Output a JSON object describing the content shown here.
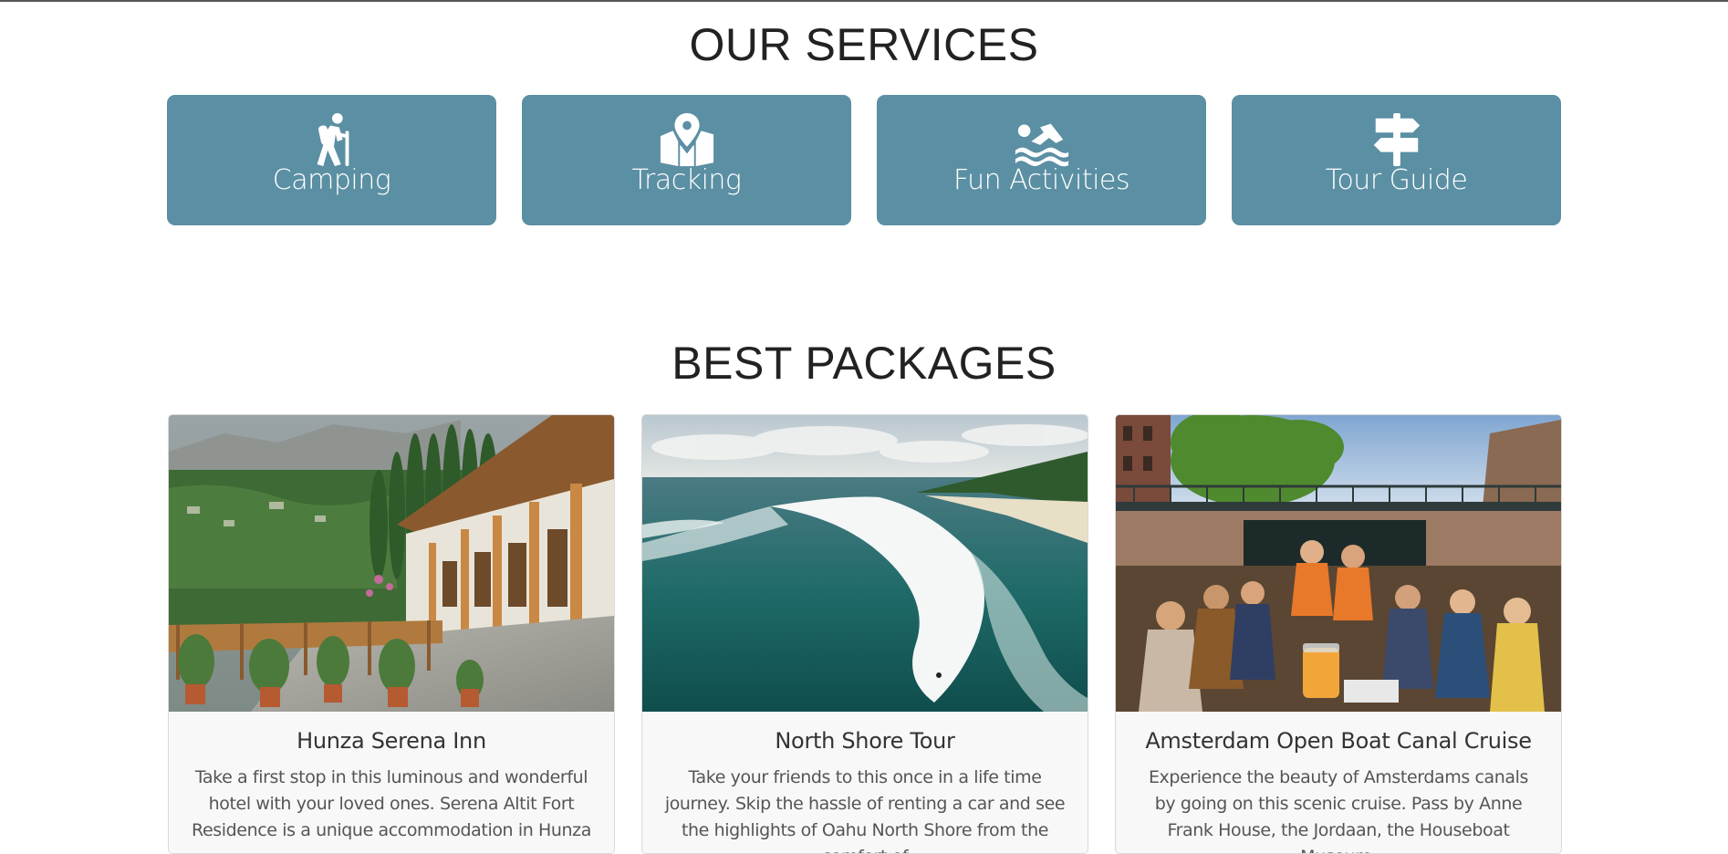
{
  "colors": {
    "service_card": "#5b8fa3",
    "heading": "#222222",
    "card_body": "#f8f8f9"
  },
  "services": {
    "title": "OUR SERVICES",
    "items": [
      {
        "label": "Camping",
        "icon": "hiking-icon"
      },
      {
        "label": "Tracking",
        "icon": "map-marked-icon"
      },
      {
        "label": "Fun Activities",
        "icon": "swimmer-icon"
      },
      {
        "label": "Tour Guide",
        "icon": "signpost-icon"
      }
    ]
  },
  "packages": {
    "title": "BEST PACKAGES",
    "items": [
      {
        "title": "Hunza Serena Inn",
        "description": "Take a first stop in this luminous and wonderful hotel with your loved ones. Serena Altit Fort Residence is a unique accommodation in Hunza",
        "image": "hotel-veranda-mountains-photo"
      },
      {
        "title": "North Shore Tour",
        "description": "Take your friends to this once in a life time journey. Skip the hassle of renting a car and see the highlights of Oahu North Shore from the comfort of",
        "image": "ocean-surf-aerial-photo"
      },
      {
        "title": "Amsterdam Open Boat Canal Cruise",
        "description": "Experience the beauty of Amsterdams canals by going on this scenic cruise. Pass by Anne Frank House, the Jordaan, the Houseboat Museum,",
        "image": "canal-boat-party-photo"
      }
    ]
  }
}
